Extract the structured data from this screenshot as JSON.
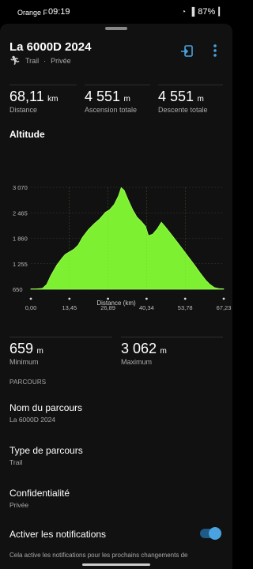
{
  "status_bar": {
    "carrier": "Orange F",
    "time": "09:19",
    "battery": "87%"
  },
  "header": {
    "title": "La 6000D 2024",
    "subtitle_type": "Trail",
    "subtitle_sep": "·",
    "subtitle_privacy": "Privée"
  },
  "stats": [
    {
      "value": "68,11",
      "unit": "km",
      "label": "Distance"
    },
    {
      "value": "4 551",
      "unit": "m",
      "label": "Ascension totale"
    },
    {
      "value": "4 551",
      "unit": "m",
      "label": "Descente totale"
    }
  ],
  "altitude": {
    "title": "Altitude",
    "minimum": {
      "value": "659",
      "unit": "m",
      "label": "Minimum"
    },
    "maximum": {
      "value": "3 062",
      "unit": "m",
      "label": "Maximum"
    }
  },
  "chart_data": {
    "type": "area",
    "xlabel": "Distance (km)",
    "ylabel": "",
    "color": "#7ef032",
    "x_ticks": [
      "0,00",
      "13,45",
      "26,89",
      "40,34",
      "53,78",
      "67,23"
    ],
    "y_ticks": [
      "3 070",
      "2 465",
      "1 860",
      "1 255",
      "650"
    ],
    "xlim": [
      0,
      67.23
    ],
    "ylim": [
      650,
      3070
    ],
    "x": [
      0,
      2,
      4,
      5.5,
      7,
      9,
      11,
      12,
      13.5,
      15,
      16.5,
      18,
      20,
      22,
      24,
      26,
      27.5,
      29,
      30.5,
      31.5,
      32.5,
      34,
      35.5,
      37,
      38.5,
      40,
      41,
      42.5,
      44,
      45.5,
      47,
      49,
      51,
      53,
      55,
      57,
      59,
      61,
      62.5,
      64,
      65.5,
      67.2
    ],
    "y": [
      660,
      660,
      670,
      760,
      980,
      1220,
      1400,
      1480,
      1540,
      1600,
      1700,
      1880,
      2060,
      2200,
      2320,
      2480,
      2540,
      2660,
      2860,
      3062,
      3000,
      2760,
      2540,
      2360,
      2260,
      2140,
      1920,
      1960,
      2080,
      2240,
      2120,
      1950,
      1770,
      1590,
      1410,
      1230,
      1040,
      860,
      760,
      690,
      665,
      660
    ]
  },
  "route_section": {
    "header": "PARCOURS",
    "items": [
      {
        "name": "Nom du parcours",
        "value": "La 6000D 2024"
      },
      {
        "name": "Type de parcours",
        "value": "Trail"
      },
      {
        "name": "Confidentialité",
        "value": "Privée"
      }
    ],
    "notifications": {
      "label": "Activer les notifications",
      "enabled": true,
      "description": "Cela active les notifications pour les prochains changements de"
    }
  }
}
